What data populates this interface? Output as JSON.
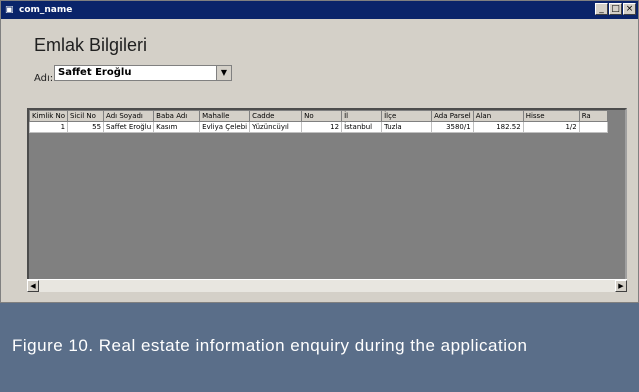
{
  "window": {
    "title": "com_name",
    "minimize": "_",
    "restore": "□",
    "close": "×"
  },
  "form": {
    "heading": "Emlak Bilgileri",
    "adi_label": "Adı:",
    "adi_value": "Saffet Eroğlu"
  },
  "grid": {
    "columns": [
      "Kimlik No",
      "Sicil No",
      "Adı Soyadı",
      "Baba Adı",
      "Mahalle",
      "Cadde",
      "No",
      "İl",
      "İlçe",
      "Ada Parsel",
      "Alan",
      "Hisse",
      "Ra"
    ],
    "rows": [
      [
        "1",
        "55",
        "Saffet Eroğlu",
        "Kasım",
        "Evliya Çelebi",
        "Yüzüncüyıl",
        "12",
        "İstanbul",
        "Tuzla",
        "3580/1",
        "182.52",
        "1/2",
        ""
      ]
    ]
  },
  "caption": {
    "text": "Figure 10. Real estate information enquiry during the application"
  }
}
